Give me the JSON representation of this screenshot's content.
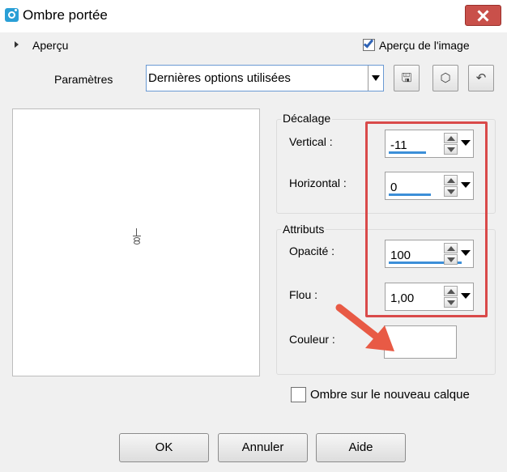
{
  "window": {
    "title": "Ombre portée",
    "close_icon": "close-icon"
  },
  "preview": {
    "apercu_label": "Aperçu",
    "apercu_image_label": "Aperçu de l'image",
    "apercu_image_checked": true
  },
  "parameters": {
    "label": "Paramètres",
    "preset_value": "Dernières options utilisées",
    "save_icon": "save-icon",
    "load_icon": "load-preset-icon",
    "reset_icon": "reset-icon"
  },
  "decalage": {
    "title": "Décalage",
    "vertical_label": "Vertical :",
    "vertical_value": "-11",
    "horizontal_label": "Horizontal :",
    "horizontal_value": "0"
  },
  "attributs": {
    "title": "Attributs",
    "opacite_label": "Opacité :",
    "opacite_value": "100",
    "flou_label": "Flou :",
    "flou_value": "1,00",
    "couleur_label": "Couleur :",
    "couleur_value": "#ffffff"
  },
  "new_layer": {
    "label": "Ombre sur le nouveau calque",
    "checked": false
  },
  "buttons": {
    "ok": "OK",
    "annuler": "Annuler",
    "aide": "Aide"
  },
  "colors": {
    "highlight": "#d94a4a",
    "slider_bar": "#3c8fd8",
    "app_icon": "#2a9fd6",
    "close_button": "#c9504a"
  }
}
